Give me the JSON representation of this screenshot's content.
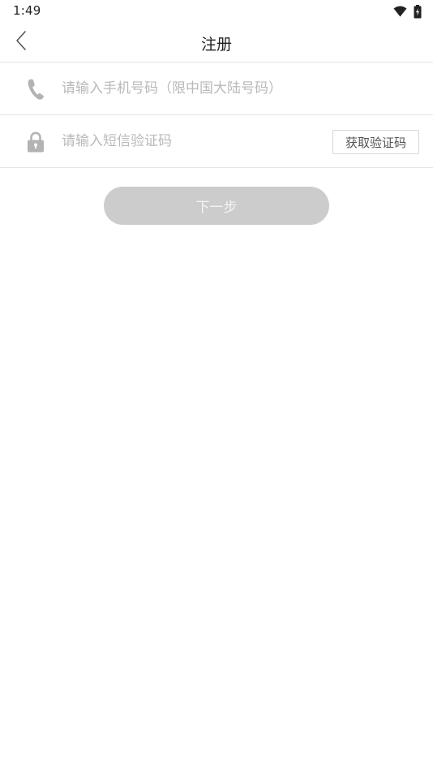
{
  "status_bar": {
    "time": "1:49",
    "icons": [
      "wifi-icon",
      "battery-icon"
    ]
  },
  "header": {
    "title": "注册",
    "back_icon": "chevron-left-icon"
  },
  "form": {
    "phone": {
      "icon": "phone-icon",
      "placeholder": "请输入手机号码（限中国大陆号码）",
      "value": ""
    },
    "sms_code": {
      "icon": "lock-icon",
      "placeholder": "请输入短信验证码",
      "value": "",
      "get_code_label": "获取验证码"
    },
    "next_label": "下一步"
  },
  "colors": {
    "background": "#ffffff",
    "divider": "#e4e4e4",
    "icon_gray": "#b3b3b3",
    "disabled_button": "#cccccc",
    "placeholder": "#b9b9b9"
  }
}
